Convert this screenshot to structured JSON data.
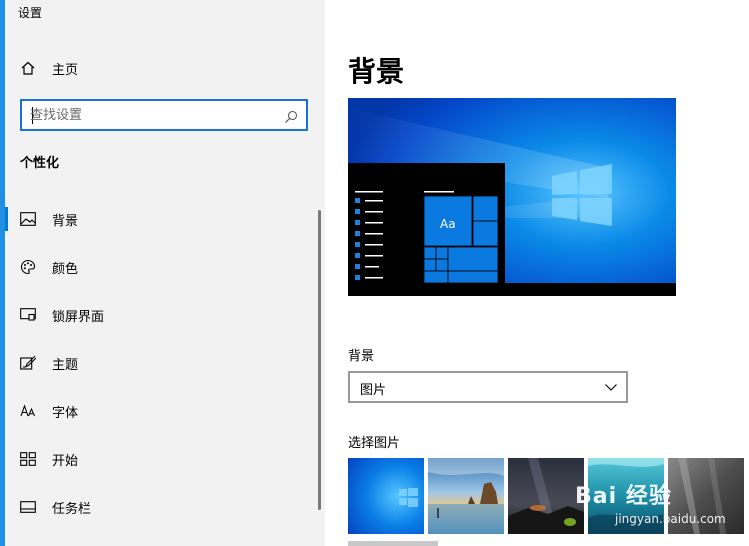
{
  "app": {
    "title": "设置"
  },
  "sidebar": {
    "home_label": "主页",
    "search_placeholder": "查找设置",
    "section_title": "个性化",
    "items": [
      {
        "label": "背景",
        "icon": "image-icon",
        "selected": true
      },
      {
        "label": "颜色",
        "icon": "palette-icon"
      },
      {
        "label": "锁屏界面",
        "icon": "lock-screen-icon"
      },
      {
        "label": "主题",
        "icon": "theme-brush-icon"
      },
      {
        "label": "字体",
        "icon": "font-icon"
      },
      {
        "label": "开始",
        "icon": "start-grid-icon"
      },
      {
        "label": "任务栏",
        "icon": "taskbar-icon"
      }
    ]
  },
  "main": {
    "page_title": "背景",
    "preview_tile_text": "Aa",
    "background_label": "背景",
    "background_value": "图片",
    "choose_picture_label": "选择图片",
    "thumbnails": [
      "windows-blue-thumb",
      "coast-rocks-thumb",
      "night-sky-thumb",
      "underwater-thumb",
      "rock-cliff-thumb"
    ]
  },
  "watermark": {
    "line1": "Bai 经验",
    "line2": "jingyan.baidu.com"
  },
  "colors": {
    "accent": "#0078d4",
    "sidebar_bg": "#f2f2f2",
    "search_border": "#1a73d9"
  }
}
